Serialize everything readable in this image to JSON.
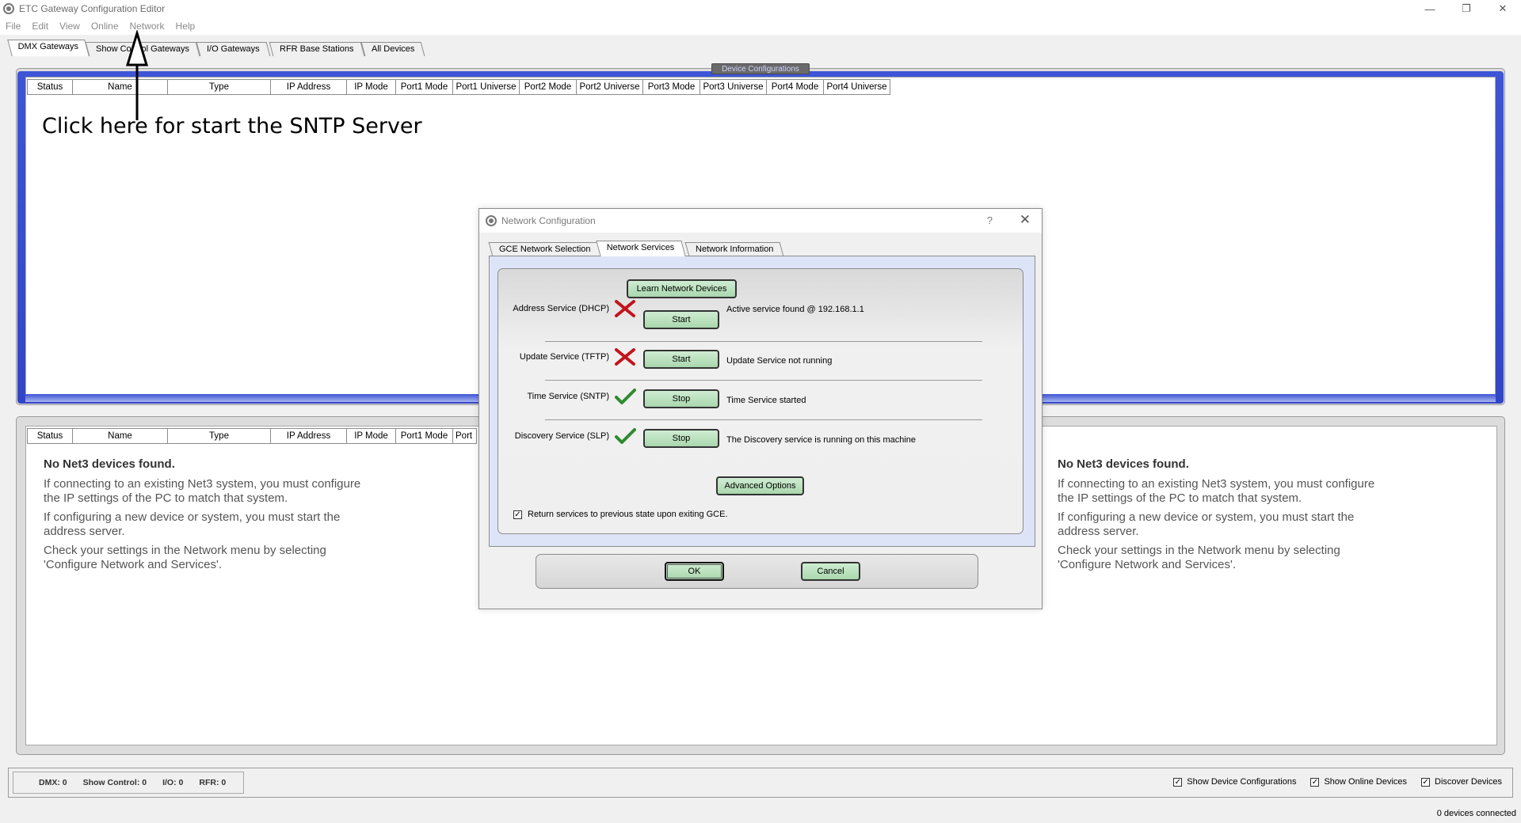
{
  "window": {
    "title": "ETC Gateway Configuration Editor",
    "controls": [
      "minimize-icon",
      "restore-icon",
      "close-icon"
    ]
  },
  "menu": [
    "File",
    "Edit",
    "View",
    "Online",
    "Network",
    "Help"
  ],
  "main_tabs": [
    "DMX Gateways",
    "Show Control Gateways",
    "I/O Gateways",
    "RFR Base Stations",
    "All Devices"
  ],
  "upper_panel": {
    "label": "Device Configurations",
    "columns": [
      "Status",
      "Name",
      "Type",
      "IP Address",
      "IP Mode",
      "Port1 Mode",
      "Port1 Universe",
      "Port2 Mode",
      "Port2 Universe",
      "Port3 Mode",
      "Port3 Universe",
      "Port4 Mode",
      "Port4 Universe"
    ]
  },
  "annotation": {
    "text": "Click here for start the SNTP Server"
  },
  "lower_panel": {
    "columns": [
      "Status",
      "Name",
      "Type",
      "IP Address",
      "IP Mode",
      "Port1 Mode",
      "Port"
    ],
    "message": {
      "title": "No Net3 devices found.",
      "p1": "If connecting to an existing Net3 system, you must configure\nthe IP settings of the PC to match that system.",
      "p2": "If configuring a new device or system, you must start the\naddress server.",
      "p3": "Check your settings in the Network menu by selecting\n'Configure Network and Services'."
    }
  },
  "status_bar": {
    "counts": [
      "DMX: 0",
      "Show Control: 0",
      "I/O: 0",
      "RFR: 0"
    ],
    "checkboxes": [
      "Show Device Configurations",
      "Show Online Devices",
      "Discover Devices"
    ],
    "devices_connected": "0 devices connected"
  },
  "dialog": {
    "title": "Network Configuration",
    "help": "?",
    "close": "✕",
    "tabs": [
      "GCE Network Selection",
      "Network Services",
      "Network Information"
    ],
    "learn_button": "Learn Network Devices",
    "services": [
      {
        "label": "Address Service (DHCP)",
        "state": "x-icon",
        "button": "Start",
        "status": "Active service found @ 192.168.1.1"
      },
      {
        "label": "Update Service (TFTP)",
        "state": "x-icon",
        "button": "Start",
        "status": "Update Service not running"
      },
      {
        "label": "Time Service (SNTP)",
        "state": "check-icon",
        "button": "Stop",
        "status": "Time Service started"
      },
      {
        "label": "Discovery Service (SLP)",
        "state": "check-icon",
        "button": "Stop",
        "status": "The Discovery service is running on this machine"
      }
    ],
    "advanced_button": "Advanced Options",
    "return_checkbox": "Return services to previous state upon exiting GCE.",
    "ok_button": "OK",
    "cancel_button": "Cancel"
  },
  "colors": {
    "panel_blue": "#3d55d6",
    "button_green": "#b5dfb8",
    "x_red": "#c0161c",
    "check_green": "#2f8a2f"
  }
}
